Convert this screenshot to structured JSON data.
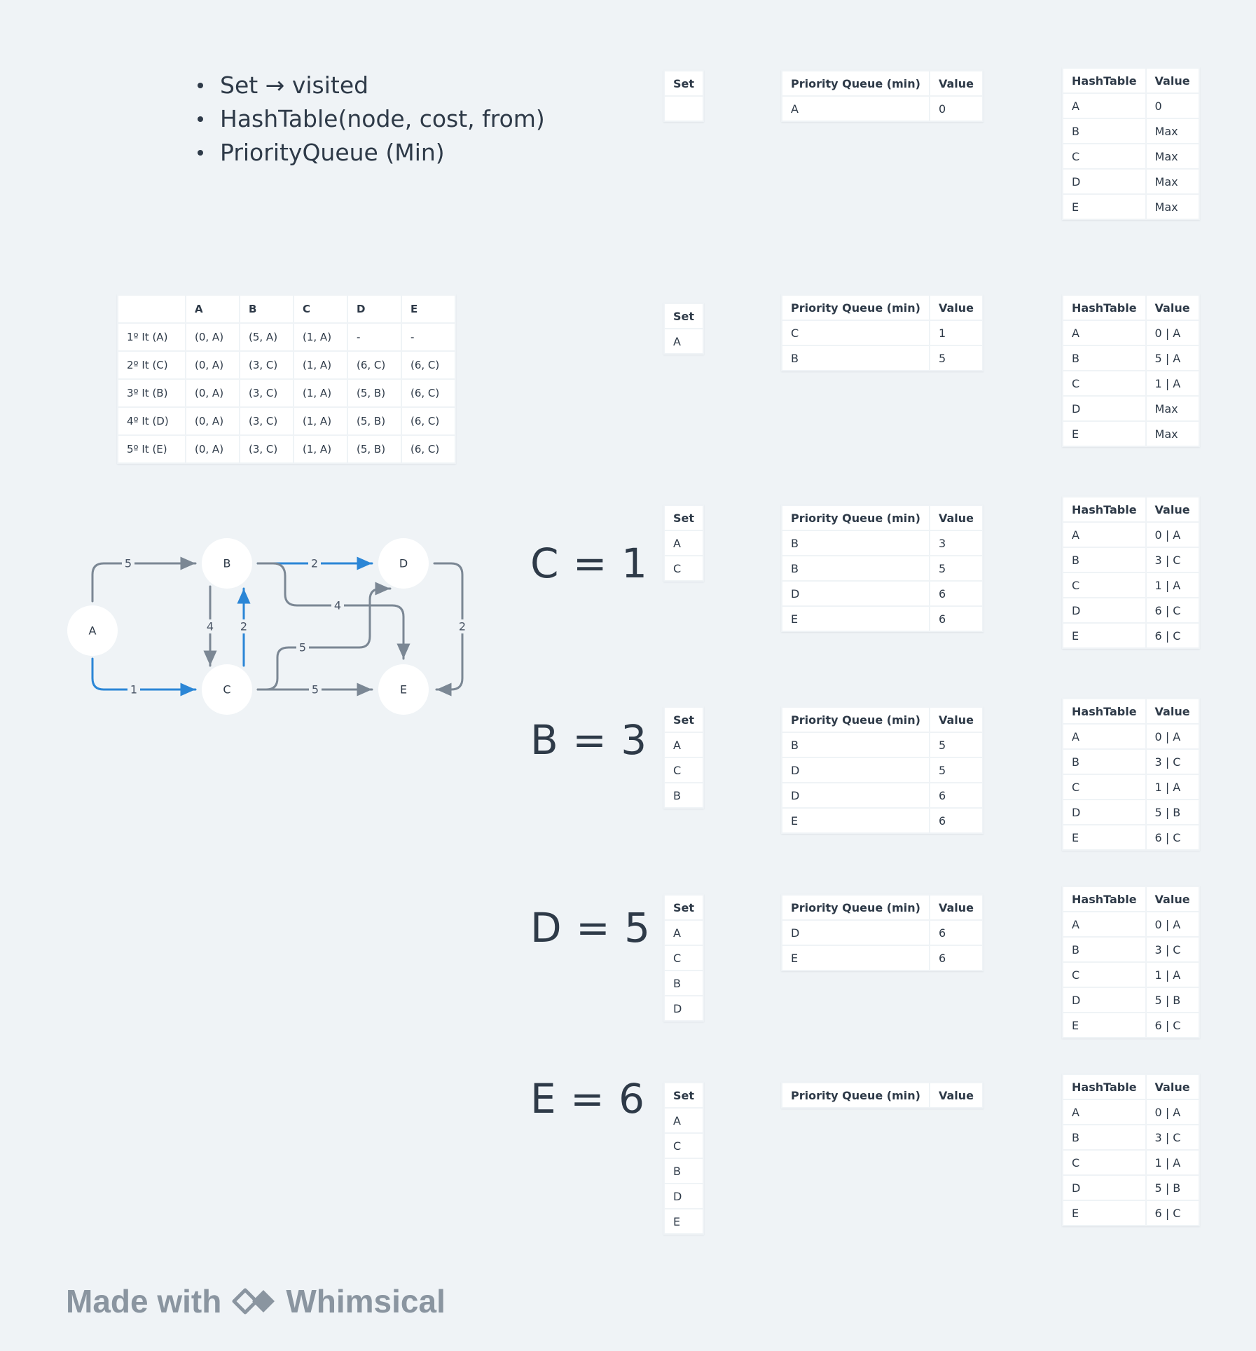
{
  "notes": [
    "Set → visited",
    "HashTable(node, cost, from)",
    "PriorityQueue (Min)"
  ],
  "headers": {
    "set": "Set",
    "pq": "Priority Queue (min)",
    "pq_value": "Value",
    "ht": "HashTable",
    "ht_value": "Value"
  },
  "iterations": {
    "columns": [
      "",
      "A",
      "B",
      "C",
      "D",
      "E"
    ],
    "rows": [
      [
        "1º It (A)",
        "(0, A)",
        "(5, A)",
        "(1, A)",
        "-",
        "-"
      ],
      [
        "2º It (C)",
        "(0, A)",
        "(3, C)",
        "(1, A)",
        "(6, C)",
        "(6, C)"
      ],
      [
        "3º It (B)",
        "(0, A)",
        "(3, C)",
        "(1, A)",
        "(5, B)",
        "(6, C)"
      ],
      [
        "4º It (D)",
        "(0, A)",
        "(3, C)",
        "(1, A)",
        "(5, B)",
        "(6, C)"
      ],
      [
        "5º It (E)",
        "(0, A)",
        "(3, C)",
        "(1, A)",
        "(5, B)",
        "(6, C)"
      ]
    ]
  },
  "graph": {
    "nodes": [
      "A",
      "B",
      "C",
      "D",
      "E"
    ],
    "edge_labels": [
      "5",
      "1",
      "2",
      "4",
      "4",
      "2",
      "5",
      "5",
      "2"
    ],
    "colors": {
      "highlight": "#2b86d6",
      "normal": "#7b8794"
    }
  },
  "steps": [
    {
      "heading": "",
      "set": [
        ""
      ],
      "pq": [
        [
          "A",
          "0"
        ]
      ],
      "ht": [
        [
          "A",
          "0"
        ],
        [
          "B",
          "Max"
        ],
        [
          "C",
          "Max"
        ],
        [
          "D",
          "Max"
        ],
        [
          "E",
          "Max"
        ]
      ]
    },
    {
      "heading": "",
      "set": [
        "A"
      ],
      "pq": [
        [
          "C",
          "1"
        ],
        [
          "B",
          "5"
        ]
      ],
      "ht": [
        [
          "A",
          "0 | A"
        ],
        [
          "B",
          "5 | A"
        ],
        [
          "C",
          "1 | A"
        ],
        [
          "D",
          "Max"
        ],
        [
          "E",
          "Max"
        ]
      ]
    },
    {
      "heading": "C = 1",
      "set": [
        "A",
        "C"
      ],
      "pq": [
        [
          "B",
          "3"
        ],
        [
          "B",
          "5"
        ],
        [
          "D",
          "6"
        ],
        [
          "E",
          "6"
        ]
      ],
      "ht": [
        [
          "A",
          "0 | A"
        ],
        [
          "B",
          "3 | C"
        ],
        [
          "C",
          "1 | A"
        ],
        [
          "D",
          "6 | C"
        ],
        [
          "E",
          "6 | C"
        ]
      ]
    },
    {
      "heading": "B = 3",
      "set": [
        "A",
        "C",
        "B"
      ],
      "pq": [
        [
          "B",
          "5"
        ],
        [
          "D",
          "5"
        ],
        [
          "D",
          "6"
        ],
        [
          "E",
          "6"
        ]
      ],
      "ht": [
        [
          "A",
          "0 | A"
        ],
        [
          "B",
          "3 | C"
        ],
        [
          "C",
          "1 | A"
        ],
        [
          "D",
          "5 | B"
        ],
        [
          "E",
          "6 | C"
        ]
      ]
    },
    {
      "heading": "D = 5",
      "set": [
        "A",
        "C",
        "B",
        "D"
      ],
      "pq": [
        [
          "D",
          "6"
        ],
        [
          "E",
          "6"
        ]
      ],
      "ht": [
        [
          "A",
          "0 | A"
        ],
        [
          "B",
          "3 | C"
        ],
        [
          "C",
          "1 | A"
        ],
        [
          "D",
          "5 | B"
        ],
        [
          "E",
          "6 | C"
        ]
      ]
    },
    {
      "heading": "E = 6",
      "set": [
        "A",
        "C",
        "B",
        "D",
        "E"
      ],
      "pq": [],
      "ht": [
        [
          "A",
          "0 | A"
        ],
        [
          "B",
          "3 | C"
        ],
        [
          "C",
          "1 | A"
        ],
        [
          "D",
          "5 | B"
        ],
        [
          "E",
          "6 | C"
        ]
      ]
    }
  ],
  "footer": {
    "made_with": "Made with",
    "brand": "Whimsical"
  }
}
